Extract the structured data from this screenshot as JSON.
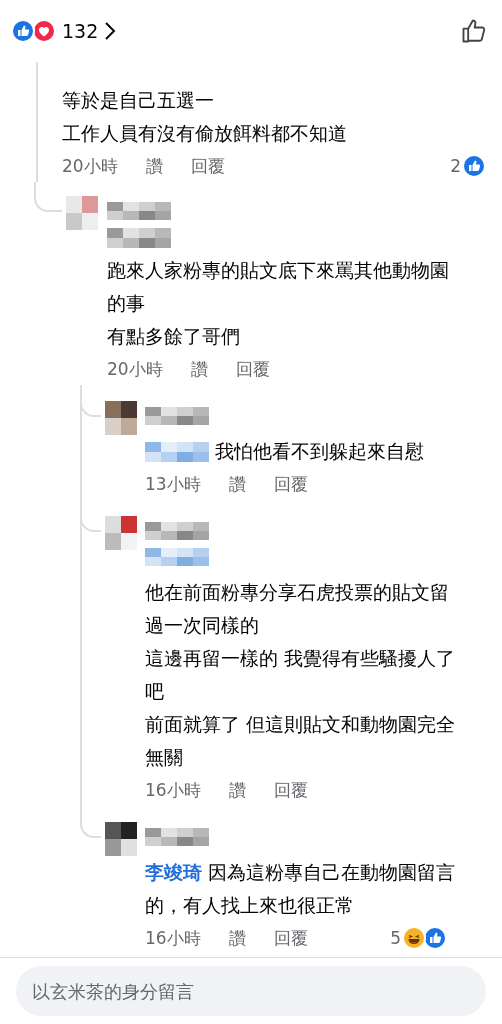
{
  "header": {
    "reactions": [
      {
        "kind": "like"
      },
      {
        "kind": "love"
      }
    ],
    "reaction_count": "132"
  },
  "comment": {
    "lines": [
      "等於是自己五選一",
      "工作人員有沒有偷放餌料都不知道"
    ],
    "time": "20小時",
    "like": "讚",
    "reply": "回覆",
    "reaction_count": "2",
    "reactions": [
      {
        "kind": "like"
      }
    ],
    "replies": [
      {
        "mention": {
          "kind": "blurred-gray-line"
        },
        "lines": [
          "跑來人家粉專的貼文底下來罵其他動物園的事",
          "有點多餘了哥們"
        ],
        "time": "20小時",
        "like": "讚",
        "reply": "回覆",
        "replies": [
          {
            "mention": {
              "kind": "blurred-blue-inline"
            },
            "lines": [
              "我怕他看不到躲起來自慰"
            ],
            "time": "13小時",
            "like": "讚",
            "reply": "回覆"
          },
          {
            "mention": {
              "kind": "blurred-blue-line"
            },
            "lines": [
              "他在前面粉專分享石虎投票的貼文留過一次同樣的",
              "這邊再留一樣的 我覺得有些騷擾人了吧",
              "前面就算了 但這則貼文和動物園完全無關"
            ],
            "time": "16小時",
            "like": "讚",
            "reply": "回覆"
          },
          {
            "mention": {
              "kind": "name",
              "name": "李竣琦"
            },
            "lines": [
              "因為這粉專自己在動物園留言的，有人找上來也很正常"
            ],
            "time": "16小時",
            "like": "讚",
            "reply": "回覆",
            "reaction_count": "5",
            "reactions": [
              {
                "kind": "haha"
              },
              {
                "kind": "like"
              }
            ]
          }
        ]
      }
    ]
  },
  "composer": {
    "placeholder": "以玄米茶的身分留言"
  }
}
